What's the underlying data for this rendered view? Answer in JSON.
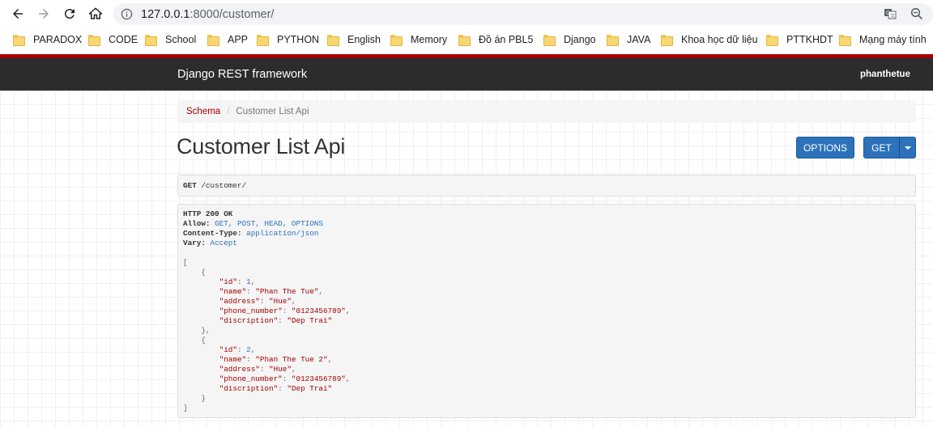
{
  "browser": {
    "url_host": "127.0.0.1",
    "url_path": ":8000/customer/",
    "bookmarks": [
      "PARADOX",
      "CODE",
      "School",
      "APP",
      "PYTHON",
      "English",
      "Memory",
      "Đồ án PBL5",
      "Django",
      "JAVA",
      "Khoa học dữ liệu",
      "PTTKHDT",
      "Mạng máy tính"
    ]
  },
  "navbar": {
    "brand": "Django REST framework",
    "user": "phanthetue"
  },
  "breadcrumb": {
    "link": "Schema",
    "separator": "/",
    "active": "Customer List Api"
  },
  "page": {
    "title": "Customer List Api",
    "options_label": "OPTIONS",
    "get_label": "GET"
  },
  "request": {
    "method": "GET",
    "path": " /customer/"
  },
  "response": {
    "status": "HTTP 200 OK",
    "headers": [
      {
        "key": "Allow:",
        "value": " GET, POST, HEAD, OPTIONS"
      },
      {
        "key": "Content-Type:",
        "value": " application/json"
      },
      {
        "key": "Vary:",
        "value": " Accept"
      }
    ],
    "records": [
      {
        "id": "1",
        "name": "\"Phan The Tue\"",
        "address": "\"Hue\"",
        "phone_number": "\"0123456789\"",
        "discription": "\"Dep Trai\""
      },
      {
        "id": "2",
        "name": "\"Phan The Tue 2\"",
        "address": "\"Hue\"",
        "phone_number": "\"0123456789\"",
        "discription": "\"Dep Trai\""
      }
    ],
    "keys": {
      "id": "\"id\"",
      "name": "\"name\"",
      "address": "\"address\"",
      "phone_number": "\"phone_number\"",
      "discription": "\"discription\""
    }
  },
  "icons": {
    "back": "arrow-left-icon",
    "forward": "arrow-right-icon",
    "reload": "reload-icon",
    "home": "home-icon",
    "info": "info-icon",
    "translate": "translate-icon",
    "zoom": "zoom-icon",
    "folder": "folder-icon"
  },
  "colors": {
    "navbar": "#2c2c2c",
    "accent_red": "#a30000",
    "button_blue": "#2c72ba"
  }
}
